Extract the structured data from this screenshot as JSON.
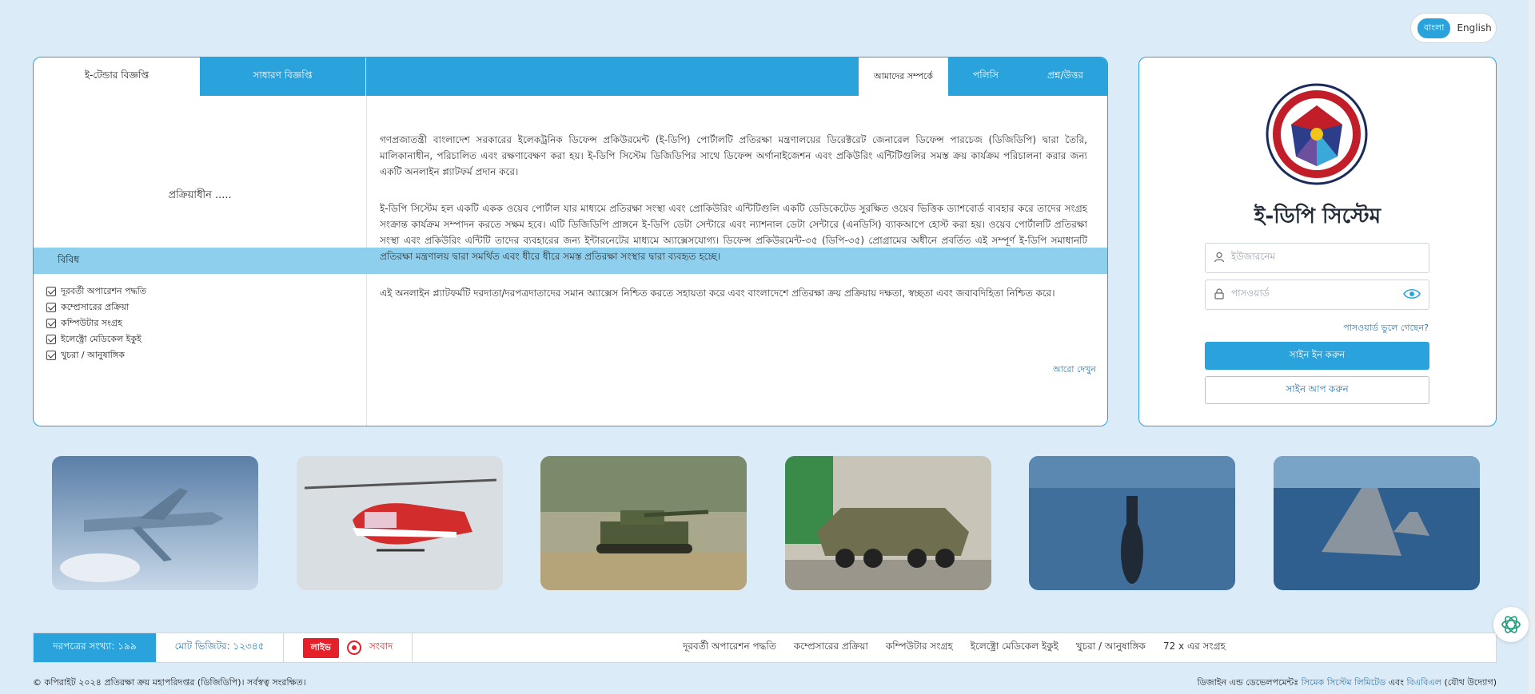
{
  "language": {
    "bangla": "বাংলা",
    "english": "English"
  },
  "tabs": {
    "etender": "ই-টেন্ডার বিজ্ঞপ্তি",
    "general": "সাধারণ বিজ্ঞপ্তি",
    "about": "আমাদের সম্পর্কে",
    "policy": "পলিসি",
    "faq": "প্রশ্ন/উত্তর"
  },
  "left": {
    "processing": "প্রক্রিয়াধীন .....",
    "misc_heading": "বিবিধ",
    "items": [
      "দূরবর্তী অপারেশন পদ্ধতি",
      "কম্প্রেসারের প্রক্রিয়া",
      "কম্পিউটার সংগ্রহ",
      "ইলেক্ট্রো মেডিকেল ইকুই",
      "খুচরা / আনুষাঙ্গিক"
    ],
    "more": "আরো দেখুন"
  },
  "about": {
    "p1": "গণপ্রজাতন্ত্রী বাংলাদেশ সরকারের ইলেকট্রনিক ডিফেন্স প্রকিউরমেন্ট (ই-ডিপি) পোর্টালটি প্রতিরক্ষা মন্ত্রণালয়ের ডিরেক্টরেট জেনারেল ডিফেন্স পারচেজ (ডিজিডিপি) দ্বারা তৈরি, মালিকানাধীন, পরিচালিত এবং রক্ষণাবেক্ষণ করা হয়। ই-ডিপি সিস্টেম ডিজিডিপির সাথে ডিফেন্স অর্গানাইজেশন এবং প্রকিউরিং এন্টিটিগুলির সমস্ত ক্রয় কার্যক্রম পরিচালনা করার জন্য একটি অনলাইন প্ল্যাটফর্ম প্রদান করে।",
    "p2": "ই-ডিপি সিস্টেম হল একটি একক ওয়েব পোর্টাল যার মাধ্যমে প্রতিরক্ষা সংস্থা এবং প্রোকিউরিং এন্টিটিগুলি একটি ডেডিকেটেড সুরক্ষিত ওয়েব ভিত্তিক ড্যাশবোর্ড ব্যবহার করে তাদের সংগ্রহ সংক্রান্ত কার্যক্রম সম্পাদন করতে সক্ষম হবে। এটি ডিজিডিপি প্রাঙ্গনে ই-ডিপি ডেটা সেন্টারে এবং ন্যাশনাল ডেটা সেন্টারে (এনডিসি) ব্যাকআপে হোস্ট করা হয়। ওয়েব পোর্টালটি প্রতিরক্ষা সংস্থা এবং প্রকিউরিং এন্টিটি তাদের ব্যবহারের জন্য ইন্টারনেটের মাধ্যমে অ্যাক্সেসযোগ্য। ডিফেন্স প্রকিউরমেন্ট-৩৫ (ডিপি-৩৫) প্রোগ্রামের অধীনে প্রবর্তিত এই সম্পূর্ণ ই-ডিপি সমাধানটি প্রতিরক্ষা মন্ত্রণালয় দ্বারা সমর্থিত এবং ধীরে ধীরে সমস্ত প্রতিরক্ষা সংস্থার দ্বারা ব্যবহৃত হচ্ছে।",
    "p3": "এই অনলাইন প্ল্যাটফর্মটি দরদাতা/দরপত্রদাতাদের সমান অ্যাক্সেস নিশ্চিত করতে সহায়তা করে এবং বাংলাদেশে প্রতিরক্ষা ক্রয় প্রক্রিয়ায় দক্ষতা, স্বচ্ছতা এবং জবাবদিহিতা নিশ্চিত করে।"
  },
  "login": {
    "title": "ই-ডিপি সিস্টেম",
    "username_placeholder": "ইউজারনেম",
    "password_placeholder": "পাসওয়ার্ড",
    "forgot": "পাসওয়ার্ড ভুলে গেছেন?",
    "signin": "সাইন ইন করুন",
    "signup": "সাইন আপ করুন"
  },
  "ticker": {
    "tender_count": "দরপত্রের সংখ্যা: ১৯৯",
    "visitors": "মোট ভিজিটর: ১২৩৪৫",
    "live": "লাইভ",
    "news": "সংবাদ",
    "items": [
      "দূরবর্তী অপারেশন পদ্ধতি",
      "কম্প্রেসারের প্রক্রিয়া",
      "কম্পিউটার সংগ্রহ",
      "ইলেক্ট্রো মেডিকেল ইকুই",
      "খুচরা / আনুষাঙ্গিক",
      "72 x এর সংগ্রহ"
    ]
  },
  "footer": {
    "copyright": "© কপিরাইট ২০২৪ প্রতিরক্ষা ক্রয় মহাপরিদপ্তর (ডিজিডিপি)। সর্বস্বত্ব সংরক্ষিত।",
    "design_prefix": "ডিজাইন এন্ড ডেভেলপমেন্টঃ ",
    "design_company1": "সিমেক সিস্টেম লিমিটেড",
    "design_and": " এবং ",
    "design_company2": "বিএবিএল",
    "design_suffix": " (যৌথ উদ্যোগ)"
  },
  "colors": {
    "accent": "#2aa3dc",
    "background": "#dcebf8",
    "live": "#e5202a"
  }
}
